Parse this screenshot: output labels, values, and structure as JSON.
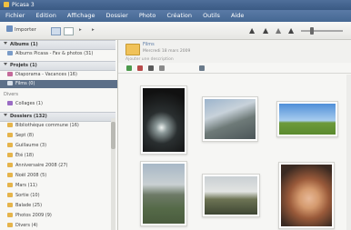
{
  "window": {
    "title": "Picasa 3"
  },
  "menu": [
    "Fichier",
    "Edition",
    "Affichage",
    "Dossier",
    "Photo",
    "Création",
    "Outils",
    "Aide"
  ],
  "toolbar": {
    "import_label": "Importer",
    "zoom_label": "Zoom"
  },
  "sidebar": {
    "sections": [
      {
        "title": "Albums (1)",
        "items": [
          {
            "label": "Albums Picasa - Fav & photos (31)"
          }
        ]
      },
      {
        "title": "Projets (1)",
        "items": [
          {
            "label": "Diaporama - Vacances (16)"
          },
          {
            "label": "Films (0)",
            "selected": true
          }
        ]
      },
      {
        "title": "Divers",
        "items": [
          {
            "label": "Collages (1)"
          }
        ]
      },
      {
        "title": "Dossiers (132)",
        "items": [
          {
            "label": "Bibliothèque commune (16)"
          },
          {
            "label": "Sept (8)"
          },
          {
            "label": "Guillaume (3)"
          },
          {
            "label": "Été (18)"
          },
          {
            "label": "Anniversaire 2008 (27)"
          },
          {
            "label": "Noël 2008 (5)"
          },
          {
            "label": "Mars (11)"
          },
          {
            "label": "Sortie (10)"
          },
          {
            "label": "Balade (25)"
          },
          {
            "label": "Photos 2009 (9)"
          },
          {
            "label": "Divers (4)"
          }
        ]
      }
    ]
  },
  "album": {
    "title": "Films",
    "count": "Mercredi 18 mars 2009",
    "more": "Ajouter une description"
  },
  "photos": [
    {
      "name": "photo-dark-light"
    },
    {
      "name": "photo-sky-hill"
    },
    {
      "name": "photo-green-field"
    },
    {
      "name": "photo-mountain-road"
    },
    {
      "name": "photo-landscape"
    },
    {
      "name": "photo-dog"
    }
  ],
  "colors": {
    "accent": "#5c6f88",
    "titlebar": "#3a5a84",
    "folder": "#e5b44b"
  }
}
